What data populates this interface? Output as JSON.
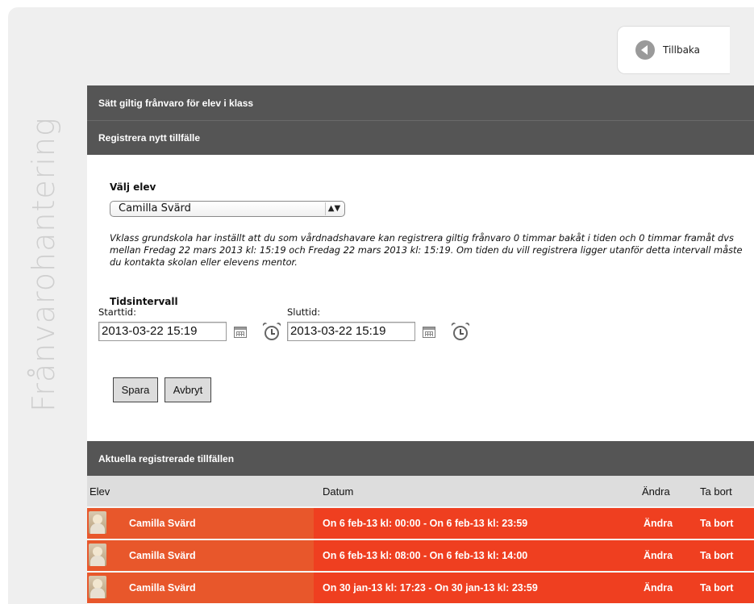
{
  "header": {
    "back_label": "Tillbaka"
  },
  "sidebar_title": "Frånvarohantering",
  "sections": {
    "set_absence": "Sätt giltig frånvaro för elev i klass",
    "register_new": "Registrera nytt tillfälle",
    "current_registered": "Aktuella registrerade tillfällen"
  },
  "form": {
    "choose_student_label": "Välj elev",
    "selected_student": "Camilla Svärd",
    "info_text": "Vklass grundskola har inställt att du som vårdnadshavare kan registrera giltig frånvaro 0 timmar bakåt i tiden och 0 timmar framåt dvs mellan Fredag 22 mars 2013 kl: 15:19 och Fredag 22 mars 2013 kl: 15:19. Om tiden du vill registrera ligger utanför detta intervall måste du kontakta skolan eller elevens mentor.",
    "time_interval_label": "Tidsintervall",
    "start_label": "Starttid:",
    "end_label": "Sluttid:",
    "start_value": "2013-03-22 15:19",
    "end_value": "2013-03-22 15:19",
    "save_label": "Spara",
    "cancel_label": "Avbryt"
  },
  "table": {
    "columns": {
      "elev": "Elev",
      "datum": "Datum",
      "andra": "Ändra",
      "ta_bort": "Ta bort"
    },
    "rows": [
      {
        "elev": "Camilla Svärd",
        "datum": "On 6 feb-13 kl: 00:00 - On 6 feb-13 kl: 23:59",
        "andra": "Ändra",
        "ta_bort": "Ta bort"
      },
      {
        "elev": "Camilla Svärd",
        "datum": "On 6 feb-13 kl: 08:00 - On 6 feb-13 kl: 14:00",
        "andra": "Ändra",
        "ta_bort": "Ta bort"
      },
      {
        "elev": "Camilla Svärd",
        "datum": "On 30 jan-13 kl: 17:23 - On 30 jan-13 kl: 23:59",
        "andra": "Ändra",
        "ta_bort": "Ta bort"
      }
    ]
  },
  "colors": {
    "bar_bg": "#555555",
    "row_elev_bg": "#e8572b",
    "row_rest_bg": "#ef3f20",
    "panel_bg": "#efefef",
    "sidebar_text": "#cfcfcf"
  },
  "icons": {
    "back": "left-arrow-circle-icon",
    "calendar": "calendar-icon",
    "clock": "alarm-clock-icon",
    "select_arrows": "up-down-arrows-icon",
    "avatar": "student-avatar"
  }
}
